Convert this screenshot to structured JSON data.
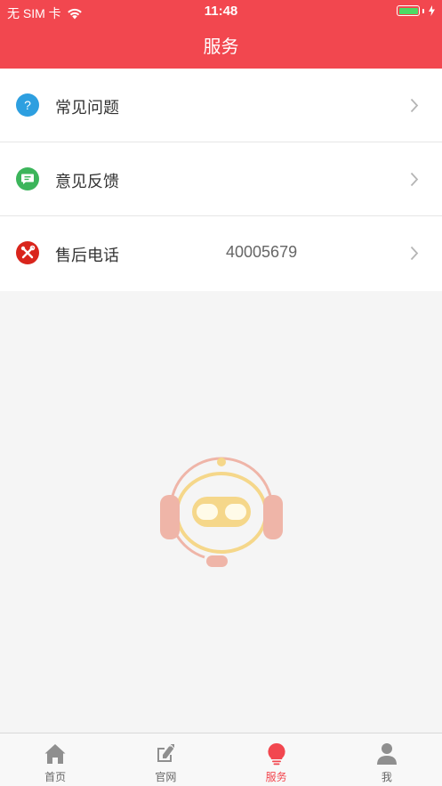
{
  "status_bar": {
    "carrier": "无 SIM 卡",
    "time": "11:48",
    "battery_color": "#4cd964"
  },
  "nav": {
    "title": "服务",
    "background": "#f2474f"
  },
  "menu": [
    {
      "label": "常见问题",
      "value": "",
      "icon": "question-icon",
      "icon_color": "#2d9fe0"
    },
    {
      "label": "意见反馈",
      "value": "",
      "icon": "feedback-icon",
      "icon_color": "#3cb55b"
    },
    {
      "label": "售后电话",
      "value": "40005679",
      "icon": "tools-icon",
      "icon_color": "#d9251c"
    }
  ],
  "mascot": {
    "icon": "robot-headset-icon"
  },
  "tabs": [
    {
      "label": "首页",
      "icon": "home-icon",
      "active": false
    },
    {
      "label": "官网",
      "icon": "website-icon",
      "active": false
    },
    {
      "label": "服务",
      "icon": "lightbulb-icon",
      "active": true
    },
    {
      "label": "我",
      "icon": "person-icon",
      "active": false
    }
  ]
}
